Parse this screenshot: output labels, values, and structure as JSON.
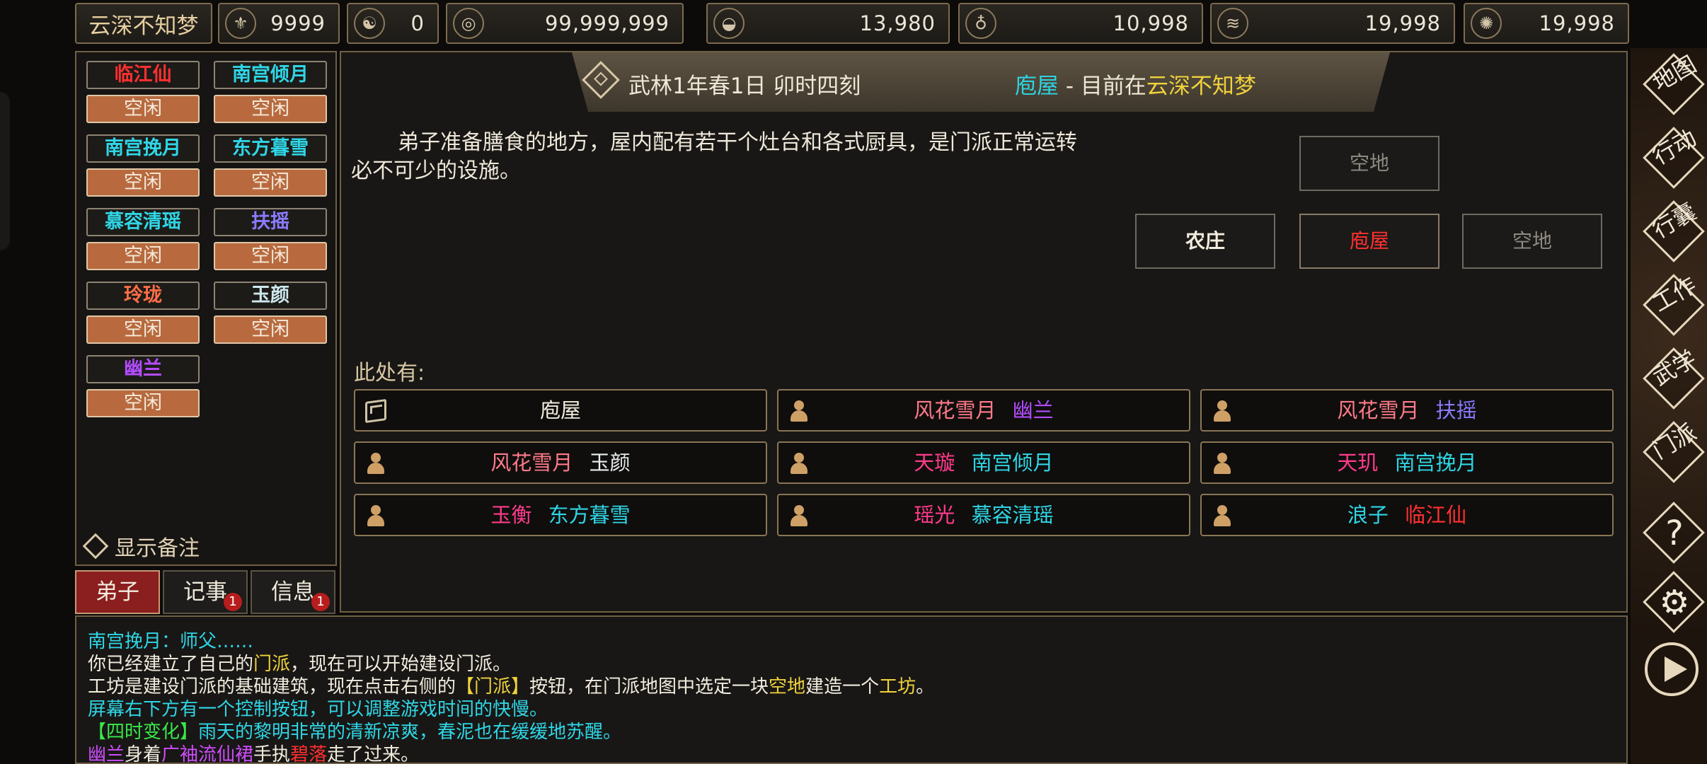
{
  "resources": {
    "sect_name": "云深不知梦",
    "items": [
      {
        "icon": "dragon-medallion-icon",
        "value": "9999"
      },
      {
        "icon": "yin-yang-icon",
        "value": "0"
      },
      {
        "icon": "coin-icon",
        "value": "99,999,999"
      },
      {
        "icon": "food-bowl-icon",
        "value": "13,980"
      },
      {
        "icon": "gourd-icon",
        "value": "10,998"
      },
      {
        "icon": "scroll-icon",
        "value": "19,998"
      },
      {
        "icon": "lion-head-icon",
        "value": "19,998"
      }
    ]
  },
  "disciples": [
    {
      "name": "临江仙",
      "status": "空闲",
      "color": "#ff3030"
    },
    {
      "name": "南宫倾月",
      "status": "空闲",
      "color": "#2fd6e6"
    },
    {
      "name": "南宫挽月",
      "status": "空闲",
      "color": "#2fd6e6"
    },
    {
      "name": "东方暮雪",
      "status": "空闲",
      "color": "#2fd6e6"
    },
    {
      "name": "慕容清瑶",
      "status": "空闲",
      "color": "#2fd6e6"
    },
    {
      "name": "扶摇",
      "status": "空闲",
      "color": "#8a7bff"
    },
    {
      "name": "玲珑",
      "status": "空闲",
      "color": "#ff6e48"
    },
    {
      "name": "玉颜",
      "status": "空闲",
      "color": "#cde8ee"
    },
    {
      "name": "幽兰",
      "status": "空闲",
      "color": "#b34cff"
    }
  ],
  "show_remarks_label": "显示备注",
  "tabs": [
    {
      "label": "弟子",
      "badge": ""
    },
    {
      "label": "记事",
      "badge": "1"
    },
    {
      "label": "信息",
      "badge": "1"
    }
  ],
  "header": {
    "date": "武林1年春1日 卯时四刻",
    "building": "庖屋",
    "separator": " - ",
    "location_prefix": "目前在",
    "sect": "云深不知梦"
  },
  "description": "弟子准备膳食的地方，屋内配有若干个灶台和各式厨具，是门派正常运转必不可少的设施。",
  "map": {
    "north": "空地",
    "west": "农庄",
    "center": "庖屋",
    "east": "空地"
  },
  "here_label": "此处有:",
  "entities": [
    {
      "icon": "box-icon",
      "title": "",
      "title_color": "",
      "name": "庖屋",
      "name_color": "#f2ecde"
    },
    {
      "icon": "person-icon",
      "title": "风花雪月",
      "title_color": "#ff7a8a",
      "name": "幽兰",
      "name_color": "#b34cff"
    },
    {
      "icon": "person-icon",
      "title": "风花雪月",
      "title_color": "#ff7a8a",
      "name": "扶摇",
      "name_color": "#8a7bff"
    },
    {
      "icon": "person-icon",
      "title": "风花雪月",
      "title_color": "#ff7a8a",
      "name": "玉颜",
      "name_color": "#e8ecee"
    },
    {
      "icon": "person-icon",
      "title": "天璇",
      "title_color": "#ff3b8c",
      "name": "南宫倾月",
      "name_color": "#2fd6e6"
    },
    {
      "icon": "person-icon",
      "title": "天玑",
      "title_color": "#ff3b8c",
      "name": "南宫挽月",
      "name_color": "#2fd6e6"
    },
    {
      "icon": "person-icon",
      "title": "玉衡",
      "title_color": "#ff3b8c",
      "name": "东方暮雪",
      "name_color": "#2fd6e6"
    },
    {
      "icon": "person-icon",
      "title": "瑶光",
      "title_color": "#ff3b8c",
      "name": "慕容清瑶",
      "name_color": "#2fd6e6"
    },
    {
      "icon": "person-icon",
      "title": "浪子",
      "title_color": "#2fd6e6",
      "name": "临江仙",
      "name_color": "#ff3030"
    }
  ],
  "log": [
    [
      {
        "t": "南宫挽月：师父……",
        "c": "#2fd6e6"
      }
    ],
    [
      {
        "t": "你已经建立了自己的",
        "c": "#f2ecde"
      },
      {
        "t": "门派",
        "c": "#f0d23c"
      },
      {
        "t": "，现在可以开始建设门派。",
        "c": "#f2ecde"
      }
    ],
    [
      {
        "t": "工坊是建设门派的基础建筑，现在点击右侧的",
        "c": "#f2ecde"
      },
      {
        "t": "【门派】",
        "c": "#f0d23c"
      },
      {
        "t": "按钮，在门派地图中选定一块",
        "c": "#f2ecde"
      },
      {
        "t": "空地",
        "c": "#f0d23c"
      },
      {
        "t": "建造一个",
        "c": "#f2ecde"
      },
      {
        "t": "工坊",
        "c": "#f0d23c"
      },
      {
        "t": "。",
        "c": "#f2ecde"
      }
    ],
    [
      {
        "t": "屏幕右下方有一个控制按钮，可以调整游戏时间的快慢。",
        "c": "#2fd6e6"
      }
    ],
    [
      {
        "t": "【四时变化】",
        "c": "#38e84a"
      },
      {
        "t": "雨天的黎明非常的清新凉爽，春泥也在缓缓地苏醒。",
        "c": "#2fd6e6"
      }
    ],
    [
      {
        "t": "幽兰",
        "c": "#d04cff"
      },
      {
        "t": "身着",
        "c": "#f2ecde"
      },
      {
        "t": "广袖流仙裙",
        "c": "#d04cff"
      },
      {
        "t": "手执",
        "c": "#f2ecde"
      },
      {
        "t": "碧落",
        "c": "#ff3030"
      },
      {
        "t": "走了过来。",
        "c": "#f2ecde"
      }
    ]
  ],
  "nav": [
    {
      "label": "地图",
      "icon": "map-nav-icon"
    },
    {
      "label": "行动",
      "icon": "action-nav-icon"
    },
    {
      "label": "行囊",
      "icon": "bag-nav-icon"
    },
    {
      "label": "工作",
      "icon": "work-nav-icon"
    },
    {
      "label": "武学",
      "icon": "martial-nav-icon"
    },
    {
      "label": "门派",
      "icon": "sect-nav-icon"
    },
    {
      "label": "?",
      "icon": "help-icon"
    },
    {
      "label": "⚙",
      "icon": "gear-icon"
    }
  ],
  "colors": {
    "border": "#6f5f45",
    "status_fill": "#b86a3e",
    "active_tab": "#8b1e1e",
    "cyan": "#2fd6e6",
    "yellow": "#f0d23c",
    "red": "#ff3030"
  }
}
